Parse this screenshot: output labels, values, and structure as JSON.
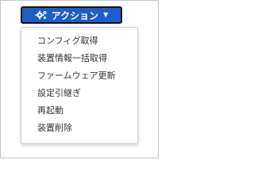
{
  "action_button": {
    "label": "アクション",
    "icon": "gears-icon",
    "caret_icon": "caret-down-icon",
    "background_color": "#1f5ec9"
  },
  "menu": {
    "items": [
      {
        "label": "コンフィグ取得"
      },
      {
        "label": "装置情報一括取得"
      },
      {
        "label": "ファームウェア更新"
      },
      {
        "label": "設定引継ぎ"
      },
      {
        "label": "再起動"
      },
      {
        "label": "装置削除"
      }
    ]
  }
}
